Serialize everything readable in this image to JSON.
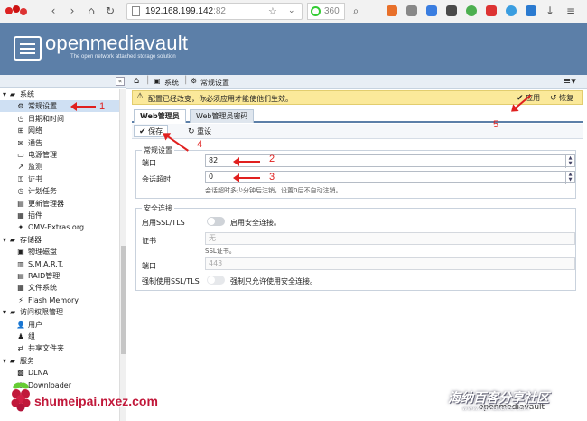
{
  "browser": {
    "url_host": "192.168.199.142",
    "url_port": ":82",
    "search_label": "360"
  },
  "header": {
    "title": "openmediavault",
    "subtitle": "The open network attached storage solution"
  },
  "sidebar": {
    "collapse": "«",
    "items": [
      {
        "label": "系统",
        "icon": "folder-icon",
        "level": 0
      },
      {
        "label": "常规设置",
        "icon": "gears-icon",
        "level": 1,
        "selected": true
      },
      {
        "label": "日期和时间",
        "icon": "clock-icon",
        "level": 1
      },
      {
        "label": "网络",
        "icon": "network-icon",
        "level": 1
      },
      {
        "label": "通告",
        "icon": "mail-icon",
        "level": 1
      },
      {
        "label": "电源管理",
        "icon": "power-icon",
        "level": 1
      },
      {
        "label": "监测",
        "icon": "chart-icon",
        "level": 1
      },
      {
        "label": "证书",
        "icon": "key-icon",
        "level": 1
      },
      {
        "label": "计划任务",
        "icon": "clock-icon",
        "level": 1
      },
      {
        "label": "更新管理器",
        "icon": "update-icon",
        "level": 1
      },
      {
        "label": "插件",
        "icon": "plugin-icon",
        "level": 1
      },
      {
        "label": "OMV-Extras.org",
        "icon": "puzzle-icon",
        "level": 1
      },
      {
        "label": "存储器",
        "icon": "folder-icon",
        "level": 0
      },
      {
        "label": "物理磁盘",
        "icon": "disk-icon",
        "level": 1
      },
      {
        "label": "S.M.A.R.T.",
        "icon": "smart-icon",
        "level": 1
      },
      {
        "label": "RAID管理",
        "icon": "raid-icon",
        "level": 1
      },
      {
        "label": "文件系统",
        "icon": "filesystem-icon",
        "level": 1
      },
      {
        "label": "Flash Memory",
        "icon": "flash-icon",
        "level": 1
      },
      {
        "label": "访问权限管理",
        "icon": "folder-icon",
        "level": 0
      },
      {
        "label": "用户",
        "icon": "user-icon",
        "level": 1
      },
      {
        "label": "组",
        "icon": "group-icon",
        "level": 1
      },
      {
        "label": "共享文件夹",
        "icon": "share-icon",
        "level": 1
      },
      {
        "label": "服务",
        "icon": "folder-icon",
        "level": 0
      },
      {
        "label": "DLNA",
        "icon": "dlna-icon",
        "level": 1
      },
      {
        "label": "Downloader",
        "icon": "download-icon",
        "level": 1
      }
    ]
  },
  "breadcrumb": {
    "items": [
      "系统",
      "常规设置"
    ]
  },
  "warning": {
    "text": "配置已经改变，你必须应用才能使他们生效。",
    "apply_label": "应用",
    "revert_label": "恢复"
  },
  "tabs": [
    {
      "label": "Web管理员",
      "active": true
    },
    {
      "label": "Web管理员密码",
      "active": false
    }
  ],
  "toolbar": {
    "save_label": "保存",
    "reset_label": "重设"
  },
  "general": {
    "legend": "常规设置",
    "port_label": "端口",
    "port_value": "82",
    "timeout_label": "会话超时",
    "timeout_value": "0",
    "timeout_hint": "会话超时多少分钟后注销，设置0后不自动注销。"
  },
  "secure": {
    "legend": "安全连接",
    "enable_label": "启用SSL/TLS",
    "enable_hint": "启用安全连接。",
    "cert_label": "证书",
    "cert_placeholder": "无",
    "cert_hint": "SSL证书。",
    "port_label": "端口",
    "port_placeholder": "443",
    "force_label": "强制使用SSL/TLS",
    "force_hint": "强制只允许使用安全连接。"
  },
  "annotations": {
    "n1": "1",
    "n2": "2",
    "n3": "3",
    "n4": "4",
    "n5": "5"
  },
  "watermarks": {
    "left": "shumeipai.nxez.com",
    "right": "海纳百客分享社区",
    "right_url": "www.hainabaike.com",
    "footer_brand": "openmediavault"
  },
  "colors": {
    "header": "#5c7fa8",
    "warning": "#fbe99a",
    "annotation": "#e0201f"
  }
}
